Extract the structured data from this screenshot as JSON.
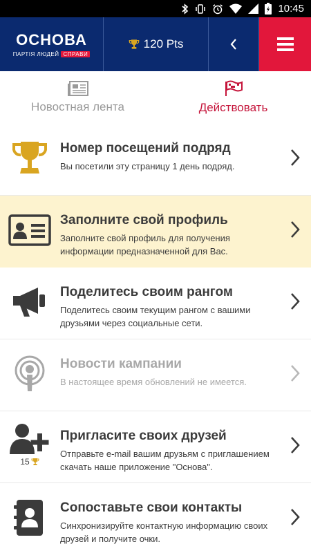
{
  "status_bar": {
    "time": "10:45",
    "icons": [
      "bluetooth-icon",
      "vibrate-icon",
      "alarm-icon",
      "wifi-icon",
      "signal-icon",
      "battery-icon"
    ]
  },
  "header": {
    "brand_name": "ОСНОВА",
    "brand_tagline": "ПАРТІЯ ЛЮДЕЙ",
    "brand_tag": "СПРАВИ",
    "points": "120 Pts",
    "colors": {
      "navy": "#0b2a6f",
      "red": "#e2173b"
    }
  },
  "tabs": [
    {
      "label": "Новостная лента",
      "icon": "newspaper-icon",
      "active": false
    },
    {
      "label": "Действовать",
      "icon": "flag-icon",
      "active": true
    }
  ],
  "actions": [
    {
      "title": "Номер посещений подряд",
      "desc": "Вы посетили эту страницу 1 день подряд.",
      "icon": "trophy-icon"
    },
    {
      "title": "Заполните свой профиль",
      "desc": "Заполните свой профиль для получения информации предназначенной для Вас.",
      "icon": "id-card-icon"
    },
    {
      "title": "Поделитесь своим рангом",
      "desc": "Поделитесь своим текущим рангом с вашими друзьями через социальные сети.",
      "icon": "megaphone-icon"
    },
    {
      "title": "Новости кампании",
      "desc": "В настоящее время обновлений не имеется.",
      "icon": "podcast-icon"
    },
    {
      "title": "Пригласите своих друзей",
      "desc": "Отправьте e-mail вашим друзьям с приглашением скачать наше приложение \"Основа\".",
      "icon": "add-user-icon",
      "badge": "15"
    },
    {
      "title": "Сопоставьте свои контакты",
      "desc": "Синхронизируйте контактную информацию своих друзей и получите очки.",
      "icon": "contacts-book-icon"
    }
  ]
}
